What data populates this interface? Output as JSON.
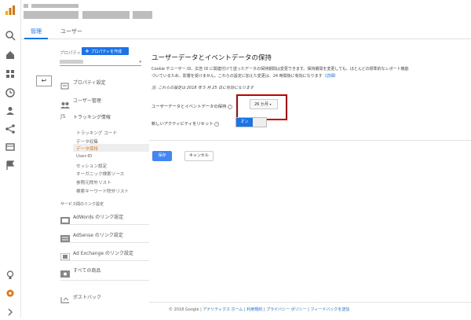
{
  "tabs": {
    "admin": "管理",
    "user": "ユーザー"
  },
  "property": {
    "label": "プロパティ",
    "create_button": "プロパティを作成"
  },
  "nav": {
    "property_settings": "プロパティ設定",
    "user_management": "ユーザー管理",
    "tracking_info": "トラッキング情報",
    "tracking_sub": [
      "トラッキング コード",
      "データ収集",
      "データ保持",
      "User-ID",
      "セッション設定",
      "オーガニック検索ソース",
      "参照元除外リスト",
      "検索キーワード除外リスト"
    ],
    "service_link_settings": "サービス間のリンク設定",
    "adwords_link": "AdWords のリンク設定",
    "adsense_link": "AdSense のリンク設定",
    "adexchange_link": "Ad Exchange のリンク設定",
    "all_products": "すべての商品",
    "postback": "ポストバック"
  },
  "main": {
    "title": "ユーザーデータとイベントデータの保持",
    "desc_line1": "Cookie やユーザー ID、広告 ID に関連付けて送ったデータの保持期間は変更できます。保持期間を変更しても、ほとんどの標準的なレポート機能",
    "desc_line2": "づいているため、影響を受けません。これらの設定に加えた変更は、24 時間後に有効になります",
    "detail_link": "詳細",
    "note": "注: これらの設定は 2018 年 5 月 25 日に有効になります",
    "retention_label": "ユーザーデータとイベントデータの保持",
    "retention_value": "26 か月",
    "reset_label": "新しいアクティビティをリセット",
    "toggle_on": "オン",
    "save": "保存",
    "cancel": "キャンセル"
  },
  "footer": {
    "copyright": "© 2018 Google",
    "links": [
      "アナリティクス ホーム",
      "利用規約",
      "プライバシー ポリシー",
      "フィードバックを送信"
    ]
  },
  "colors": {
    "accent": "#1a73e8",
    "highlight_box": "#c00000",
    "orange": "#e8710a"
  }
}
